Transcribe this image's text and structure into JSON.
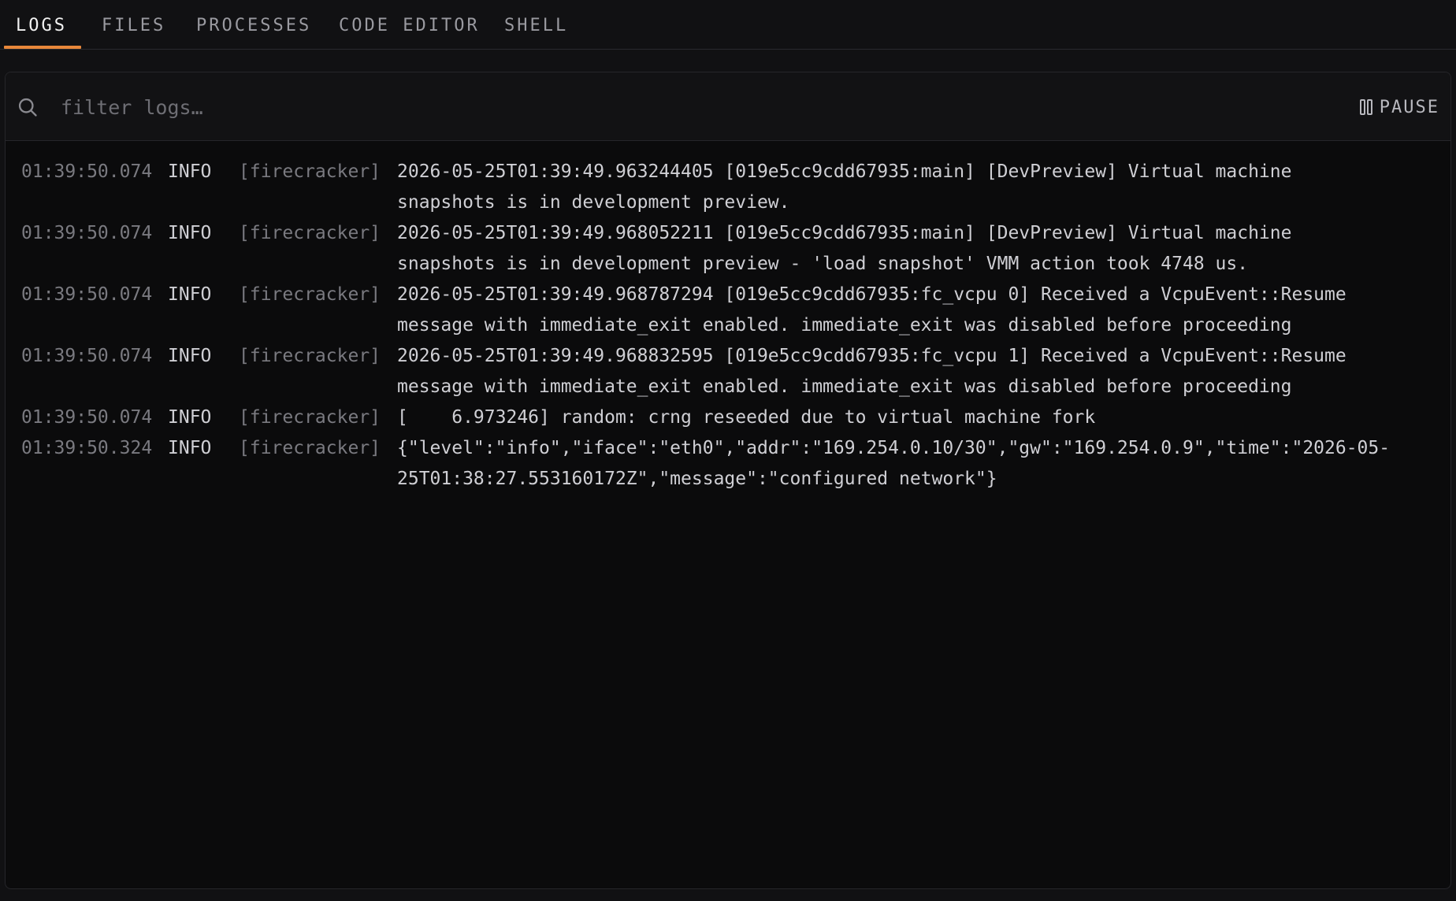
{
  "tabs": [
    {
      "label": "LOGS",
      "active": true
    },
    {
      "label": "FILES",
      "active": false
    },
    {
      "label": "PROCESSES",
      "active": false
    },
    {
      "label": "CODE EDITOR",
      "active": false
    },
    {
      "label": "SHELL",
      "active": false
    }
  ],
  "accent_color": "#e8873a",
  "filter": {
    "placeholder": "filter logs…",
    "value": ""
  },
  "pause_label": "PAUSE",
  "logs": [
    {
      "time": "01:39:50.074",
      "level": "INFO",
      "source": "[firecracker]",
      "message_lines": [
        "2026-05-25T01:39:49.963244405 [019e5cc9cdd67935:main] [DevPreview] Virtual machine",
        "snapshots is in development preview."
      ]
    },
    {
      "time": "01:39:50.074",
      "level": "INFO",
      "source": "[firecracker]",
      "message_lines": [
        "2026-05-25T01:39:49.968052211 [019e5cc9cdd67935:main] [DevPreview] Virtual machine",
        "snapshots is in development preview - 'load snapshot' VMM action took 4748 us."
      ]
    },
    {
      "time": "01:39:50.074",
      "level": "INFO",
      "source": "[firecracker]",
      "message_lines": [
        "2026-05-25T01:39:49.968787294 [019e5cc9cdd67935:fc_vcpu 0] Received a VcpuEvent::Resume",
        "message with immediate_exit enabled. immediate_exit was disabled before proceeding"
      ]
    },
    {
      "time": "01:39:50.074",
      "level": "INFO",
      "source": "[firecracker]",
      "message_lines": [
        "2026-05-25T01:39:49.968832595 [019e5cc9cdd67935:fc_vcpu 1] Received a VcpuEvent::Resume",
        "message with immediate_exit enabled. immediate_exit was disabled before proceeding"
      ]
    },
    {
      "time": "01:39:50.074",
      "level": "INFO",
      "source": "[firecracker]",
      "message_lines": [
        "[    6.973246] random: crng reseeded due to virtual machine fork"
      ]
    },
    {
      "time": "01:39:50.324",
      "level": "INFO",
      "source": "[firecracker]",
      "message_lines": [
        "{\"level\":\"info\",\"iface\":\"eth0\",\"addr\":\"169.254.0.10/30\",\"gw\":\"169.254.0.9\",\"time\":\"2026-05-",
        "25T01:38:27.553160172Z\",\"message\":\"configured network\"}"
      ]
    }
  ]
}
